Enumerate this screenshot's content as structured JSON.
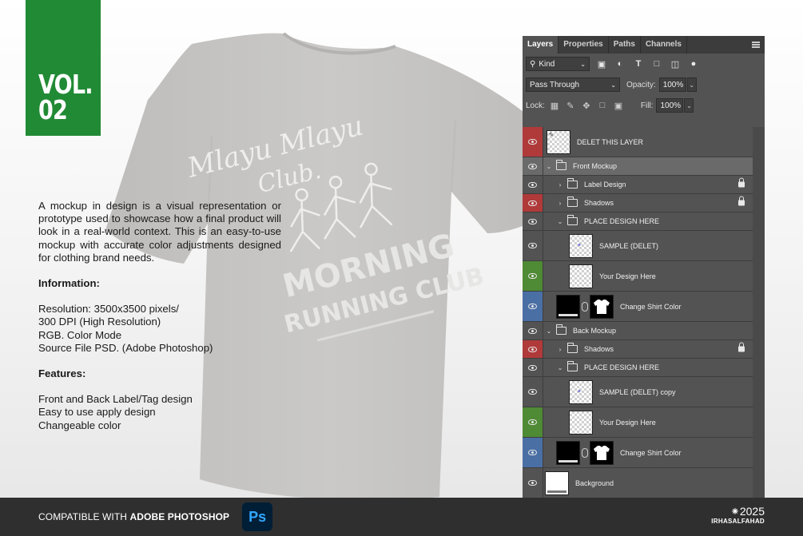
{
  "badge": {
    "line1": "VOL.",
    "line2": "02"
  },
  "shirt_print": {
    "script_line1": "Mlayu Mlayu",
    "script_line2": "Club.",
    "title_line1": "MORNING",
    "title_line2": "RUNNING CLUB"
  },
  "description": {
    "intro": "A mockup in design is a visual representation or prototype used to showcase how a final product will look in a real-world context. This is an easy-to-use mockup with accurate color adjustments designed for clothing brand needs.",
    "info_heading": "Information:",
    "info_items": [
      "Resolution: 3500x3500 pixels/",
      "300 DPI (High Resolution)",
      "RGB. Color Mode",
      "Source File PSD. (Adobe Photoshop)"
    ],
    "features_heading": "Features:",
    "features_items": [
      "Front and Back Label/Tag design",
      "Easy to use apply design",
      "Changeable color"
    ]
  },
  "panel": {
    "tabs": [
      "Layers",
      "Properties",
      "Paths",
      "Channels"
    ],
    "active_tab": "Layers",
    "filter_kind": "Kind",
    "blend_mode": "Pass Through",
    "opacity_label": "Opacity:",
    "opacity_value": "100%",
    "lock_label": "Lock:",
    "fill_label": "Fill:",
    "fill_value": "100%",
    "layers": [
      {
        "name": "DELET THIS LAYER",
        "eye_color": "#b03a3a",
        "type": "thumb",
        "indent": 0
      },
      {
        "name": "Front Mockup",
        "eye_color": "",
        "type": "group-open",
        "indent": 0,
        "selected": true
      },
      {
        "name": "Label Design",
        "eye_color": "",
        "type": "group-closed",
        "indent": 1,
        "locked": true
      },
      {
        "name": "Shadows",
        "eye_color": "#b03a3a",
        "type": "group-closed",
        "indent": 1,
        "locked": true
      },
      {
        "name": "PLACE DESIGN HERE",
        "eye_color": "",
        "type": "group-open",
        "indent": 1
      },
      {
        "name": "SAMPLE (DELET)",
        "eye_color": "",
        "type": "thumb",
        "indent": 2
      },
      {
        "name": "Your Design Here",
        "eye_color": "#4f8a35",
        "type": "thumb",
        "indent": 2
      },
      {
        "name": "Change Shirt Color",
        "eye_color": "#4a6fa5",
        "type": "fill-mask",
        "indent": 1
      },
      {
        "name": "Back Mockup",
        "eye_color": "",
        "type": "group-open",
        "indent": 0
      },
      {
        "name": "Shadows",
        "eye_color": "#b03a3a",
        "type": "group-closed",
        "indent": 1,
        "locked": true
      },
      {
        "name": "PLACE DESIGN HERE",
        "eye_color": "",
        "type": "group-open",
        "indent": 1
      },
      {
        "name": "SAMPLE (DELET) copy",
        "eye_color": "",
        "type": "thumb",
        "indent": 2
      },
      {
        "name": "Your Design Here",
        "eye_color": "#4f8a35",
        "type": "thumb",
        "indent": 2
      },
      {
        "name": "Change Shirt Color",
        "eye_color": "#4a6fa5",
        "type": "fill-mask",
        "indent": 1
      },
      {
        "name": "Background",
        "eye_color": "",
        "type": "background",
        "indent": 0
      }
    ]
  },
  "footer": {
    "compat_prefix": "COMPATIBLE WITH ",
    "compat_app": "ADOBE PHOTOSHOP",
    "logo_text": "Ps",
    "year": "⁕2025",
    "author": "IRHASALFAHAD"
  },
  "colors": {
    "badge_green": "#218a35",
    "footer_bg": "#2f2f2f",
    "panel_bg": "#535353",
    "shirt": "#c7c6c4"
  }
}
